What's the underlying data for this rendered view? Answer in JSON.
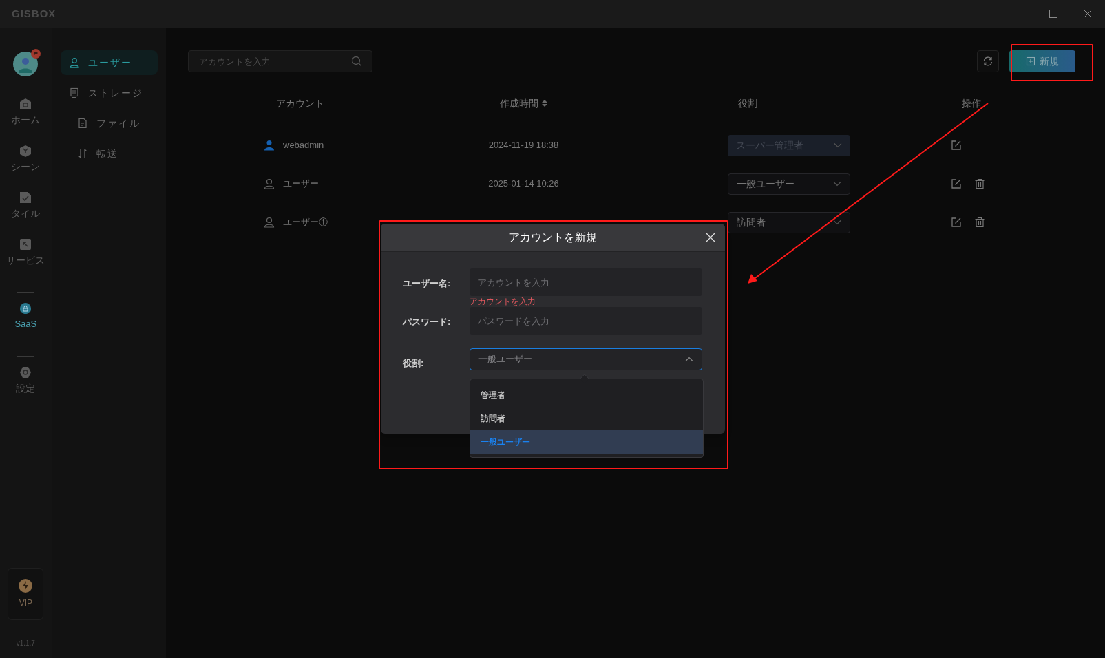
{
  "app": {
    "logo": "GISBOX"
  },
  "rail": {
    "items": [
      {
        "kind": "item",
        "label": "ホーム",
        "selected": false
      },
      {
        "kind": "item",
        "label": "シーン",
        "selected": false
      },
      {
        "kind": "item",
        "label": "タイル",
        "selected": false
      },
      {
        "kind": "item",
        "label": "サービス",
        "selected": false
      },
      {
        "kind": "divider"
      },
      {
        "kind": "item",
        "label": "SaaS",
        "selected": true
      },
      {
        "kind": "divider"
      },
      {
        "kind": "item",
        "label": "設定",
        "selected": false
      }
    ],
    "vip": "VIP",
    "version": "v1.1.7"
  },
  "nav": {
    "items": [
      {
        "label": "ユーザー",
        "selected": true
      },
      {
        "label": "ストレージ",
        "selected": false,
        "children": [
          {
            "label": "ファイル",
            "selected": false
          },
          {
            "label": "転送",
            "selected": false
          }
        ]
      }
    ]
  },
  "search": {
    "placeholder": "アカウントを入力"
  },
  "new_button": "新規",
  "table": {
    "columns": [
      {
        "label": "アカウント",
        "sortable": false
      },
      {
        "label": "作成時間",
        "sortable": true
      },
      {
        "label": "役割",
        "sortable": false
      },
      {
        "label": "操作",
        "sortable": false
      }
    ],
    "rows": [
      {
        "kind": "admin",
        "account": "webadmin",
        "created": "2024-11-19 18:38",
        "role": "スーパー管理者",
        "disabled": true,
        "deletable": false
      },
      {
        "kind": "user",
        "account": "ユーザー",
        "created": "2025-01-14 10:26",
        "role": "一般ユーザー",
        "disabled": false,
        "deletable": true
      },
      {
        "kind": "user",
        "account": "ユーザー①",
        "role": "訪問者",
        "disabled": false,
        "deletable": true
      }
    ]
  },
  "dialog": {
    "title": "アカウントを新規",
    "fields": [
      {
        "kind": "text",
        "label": "ユーザー名:",
        "placeholder": "アカウントを入力",
        "error": "アカウントを入力"
      },
      {
        "kind": "text",
        "label": "パスワード:",
        "placeholder": "パスワードを入力"
      },
      {
        "kind": "select",
        "label": "役割:",
        "value": "一般ユーザー",
        "expanded": true
      }
    ],
    "options": [
      {
        "label": "管理者",
        "selected": false
      },
      {
        "label": "訪問者",
        "selected": false
      },
      {
        "label": "一般ユーザー",
        "selected": true
      }
    ]
  },
  "annotations": [
    {
      "kind": "box"
    },
    {
      "kind": "box"
    },
    {
      "kind": "arrow"
    }
  ]
}
